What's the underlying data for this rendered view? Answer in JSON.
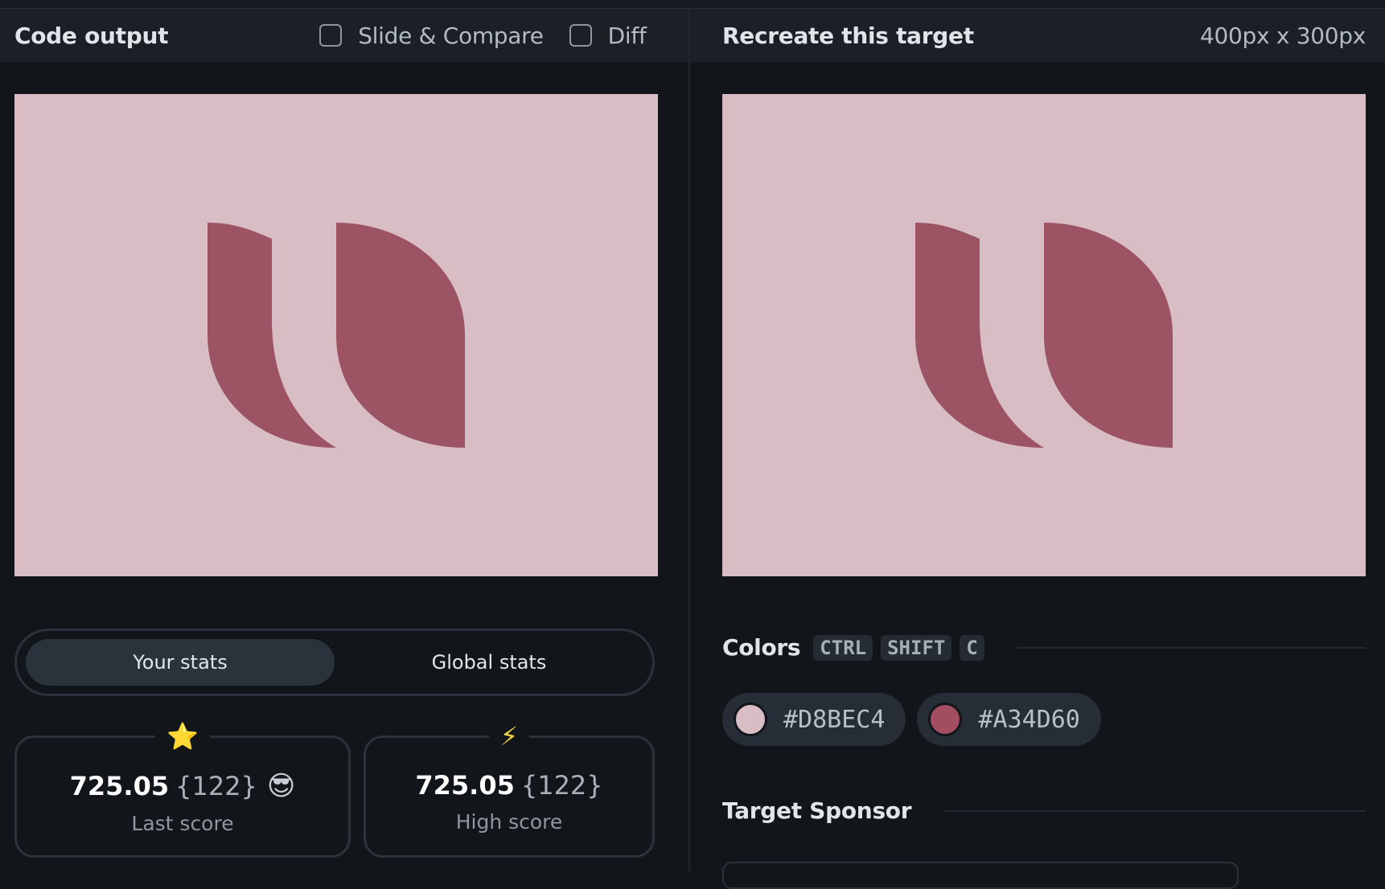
{
  "left_panel": {
    "title": "Code output",
    "slide_compare_label": "Slide & Compare",
    "diff_label": "Diff"
  },
  "right_panel": {
    "title": "Recreate this target",
    "dimensions": "400px x 300px"
  },
  "stats": {
    "tabs": [
      {
        "label": "Your stats",
        "active": true
      },
      {
        "label": "Global stats",
        "active": false
      }
    ],
    "last": {
      "icon": "star-icon",
      "glyph": "⭐",
      "score": "725.05",
      "count": "{122}",
      "emoji": "😎",
      "label": "Last score"
    },
    "high": {
      "icon": "lightning-icon",
      "glyph": "⚡",
      "score": "725.05",
      "count": "{122}",
      "label": "High score"
    }
  },
  "colors": {
    "title": "Colors",
    "shortcut": [
      "CTRL",
      "SHIFT",
      "C"
    ],
    "swatches": [
      {
        "label": "#D8BEC4",
        "color": "#D8BEC4"
      },
      {
        "label": "#A34D60",
        "color": "#A34D60"
      }
    ]
  },
  "sponsor": {
    "title": "Target Sponsor"
  }
}
